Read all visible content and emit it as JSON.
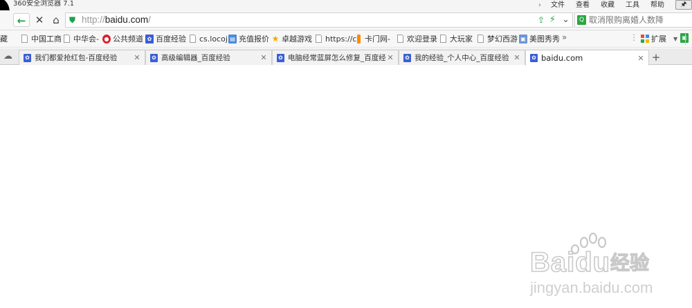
{
  "titlebar": {
    "app_title": "360安全浏览器 7.1",
    "menu": [
      "文件",
      "查看",
      "收藏",
      "工具",
      "帮助"
    ],
    "menu_chevron": "›",
    "pin_glyph": "🖈"
  },
  "addressbar": {
    "url_prefix": "http://",
    "url_host": "baidu.com",
    "url_suffix": "/",
    "search_text": "取消限购离婚人数降"
  },
  "bookmarks": {
    "cut_label": "藏",
    "items": [
      "中国工商",
      "中华会-",
      "公共频道",
      "百度经验",
      "cs.locoj",
      "充值报价",
      "卓越游戏",
      "https://c",
      "卡门网-",
      "欢迎登录",
      "大玩家",
      "梦幻西游",
      "美图秀秀"
    ],
    "extensions_label": "扩展"
  },
  "tabs": [
    {
      "title": "我们都爱抢红包-百度经验"
    },
    {
      "title": "高级编辑器_百度经验"
    },
    {
      "title": "电脑经常蓝屏怎么修复_百度经"
    },
    {
      "title": "我的经验_个人中心_百度经验"
    },
    {
      "title": "baidu.com"
    }
  ],
  "watermark": {
    "brand": "Baidu",
    "cn": "经验",
    "url": "jingyan.baidu.com"
  }
}
